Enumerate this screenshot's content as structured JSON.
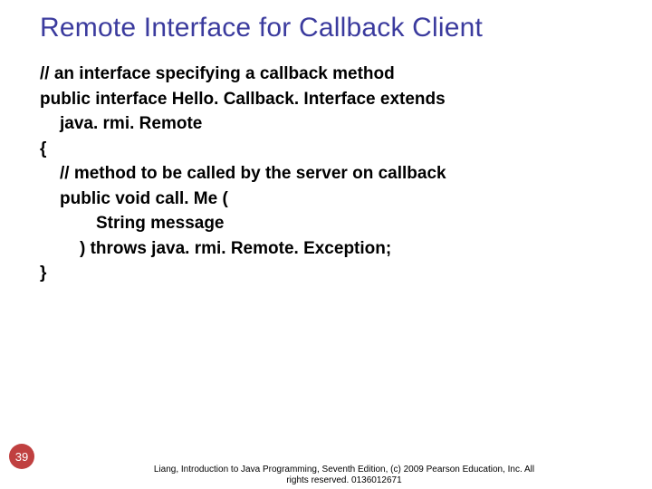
{
  "title": "Remote Interface for Callback Client",
  "code": {
    "l1": "// an interface specifying a callback method",
    "l2": "public interface Hello. Callback. Interface extends",
    "l3": "java. rmi. Remote",
    "l4": "{",
    "l5": "// method to be called by the server on callback",
    "l6": "public void call. Me (",
    "l7": "String message",
    "l8": ") throws java. rmi. Remote. Exception;",
    "l9": "}"
  },
  "page_number": "39",
  "footer_line1": "Liang, Introduction to Java Programming, Seventh Edition, (c) 2009 Pearson Education, Inc. All",
  "footer_line2": "rights reserved. 0136012671"
}
